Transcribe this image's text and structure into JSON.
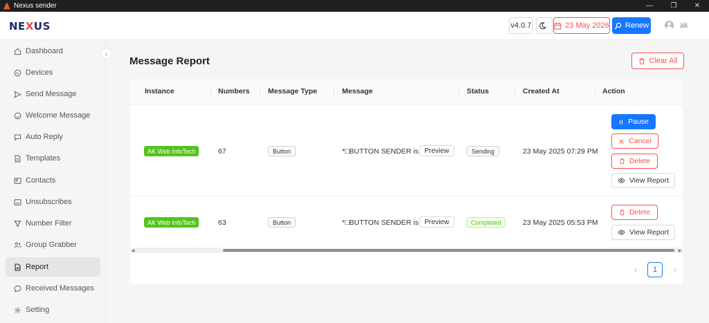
{
  "window": {
    "title": "Nexus sender"
  },
  "header": {
    "logo": {
      "part1": "NE",
      "part2": "X",
      "part3": "US"
    },
    "version": "v4.0.7",
    "date": "23 May 2026",
    "renew_label": "Renew",
    "user": "ak"
  },
  "sidebar": {
    "items": [
      {
        "label": "Dashboard",
        "icon": "home-icon"
      },
      {
        "label": "Devices",
        "icon": "whatsapp-icon"
      },
      {
        "label": "Send Message",
        "icon": "send-icon"
      },
      {
        "label": "Welcome Message",
        "icon": "smile-icon"
      },
      {
        "label": "Auto Reply",
        "icon": "chat-icon"
      },
      {
        "label": "Templates",
        "icon": "file-icon"
      },
      {
        "label": "Contacts",
        "icon": "contact-card-icon"
      },
      {
        "label": "Unsubscribes",
        "icon": "user-card-icon"
      },
      {
        "label": "Number Filter",
        "icon": "filter-icon"
      },
      {
        "label": "Group Grabber",
        "icon": "group-icon"
      },
      {
        "label": "Report",
        "icon": "report-icon"
      },
      {
        "label": "Received Messages",
        "icon": "message-icon"
      },
      {
        "label": "Setting",
        "icon": "gear-icon"
      }
    ]
  },
  "main": {
    "title": "Message Report",
    "clear_all_label": "Clear All",
    "columns": [
      "Instance",
      "Numbers",
      "Message Type",
      "Message",
      "Status",
      "Created At",
      "Action"
    ],
    "rows": [
      {
        "instance": "AK Web InfoTech",
        "numbers": "67",
        "type": "Button",
        "message": "*□BUTTON SENDER is ...",
        "preview": "Preview",
        "status": "Sending",
        "created": "23 May 2025 07:29 PM",
        "actions": {
          "pause": "Pause",
          "cancel": "Cancel",
          "delete": "Delete",
          "view": "View Report"
        }
      },
      {
        "instance": "AK Web InfoTech",
        "numbers": "63",
        "type": "Button",
        "message": "*□BUTTON SENDER is ...",
        "preview": "Preview",
        "status": "Completed",
        "created": "23 May 2025 05:53 PM",
        "actions": {
          "delete": "Delete",
          "view": "View Report"
        }
      }
    ],
    "pagination": {
      "current": "1"
    }
  },
  "colors": {
    "primary": "#1677ff",
    "danger": "#ff4d4f",
    "success": "#52c41a"
  }
}
